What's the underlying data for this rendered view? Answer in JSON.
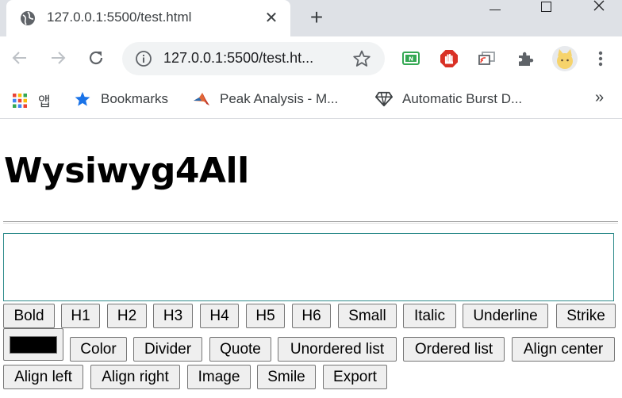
{
  "browser": {
    "tab_title": "127.0.0.1:5500/test.html",
    "tab_close": "✕",
    "new_tab": "+",
    "url": "127.0.0.1:5500/test.ht...",
    "bookmarks": [
      {
        "label": "앱",
        "icon": "apps-grid-icon"
      },
      {
        "label": "Bookmarks",
        "icon": "star-icon"
      },
      {
        "label": "Peak Analysis - M...",
        "icon": "matlab-icon"
      },
      {
        "label": "Automatic Burst D...",
        "icon": "diamond-logo-icon"
      }
    ],
    "more": "»"
  },
  "page": {
    "title": "Wysiwyg4All",
    "buttons_row1": [
      "Bold",
      "H1",
      "H2",
      "H3",
      "H4",
      "H5",
      "H6",
      "Small",
      "Italic",
      "Underline",
      "Strike"
    ],
    "color_value": "#000000",
    "buttons_row2": [
      "Color",
      "Divider",
      "Quote",
      "Unordered list",
      "Ordered list",
      "Align center"
    ],
    "buttons_row3": [
      "Align left",
      "Align right",
      "Image",
      "Smile",
      "Export"
    ]
  },
  "colors": {
    "tabstrip": "#dee1e6",
    "editor_border": "#2e8b8b"
  }
}
